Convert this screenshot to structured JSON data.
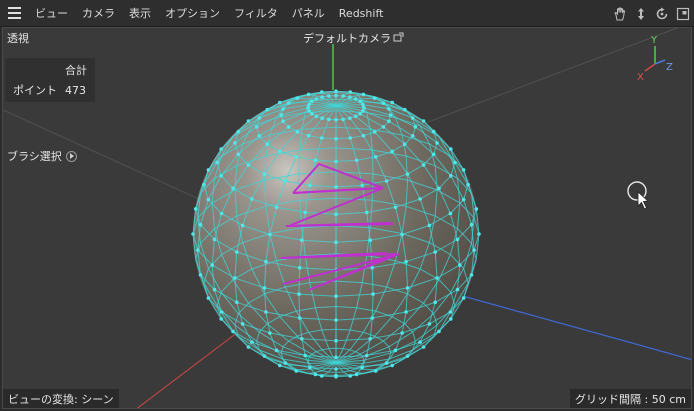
{
  "menubar": {
    "items": [
      "ビュー",
      "カメラ",
      "表示",
      "オプション",
      "フィルタ",
      "パネル",
      "Redshift"
    ],
    "nav_icons": [
      "hand-pan-icon",
      "move-arrows-icon",
      "rotate-icon",
      "maximize-icon"
    ]
  },
  "viewport": {
    "view_name": "透視",
    "camera_label": "デフォルトカメラ",
    "camera_icon": "camera-link-icon",
    "stats": {
      "header": "合計",
      "rows": [
        {
          "label": "ポイント",
          "value": "473"
        }
      ]
    },
    "brush_label": "ブラシ選択",
    "transform_label": "ビューの変換: シーン",
    "grid_spacing": "グリッド間隔 : 50 cm",
    "axis_gizmo": {
      "y": "Y",
      "x": "X",
      "z": "Z"
    }
  },
  "colors": {
    "background": "#3a3a3a",
    "mesh_wire": "#3fd6d8",
    "selected_edges": "#c030d0",
    "axis_x": "#d24a4a",
    "axis_y": "#5fd85f",
    "axis_z": "#4a7ad8"
  }
}
